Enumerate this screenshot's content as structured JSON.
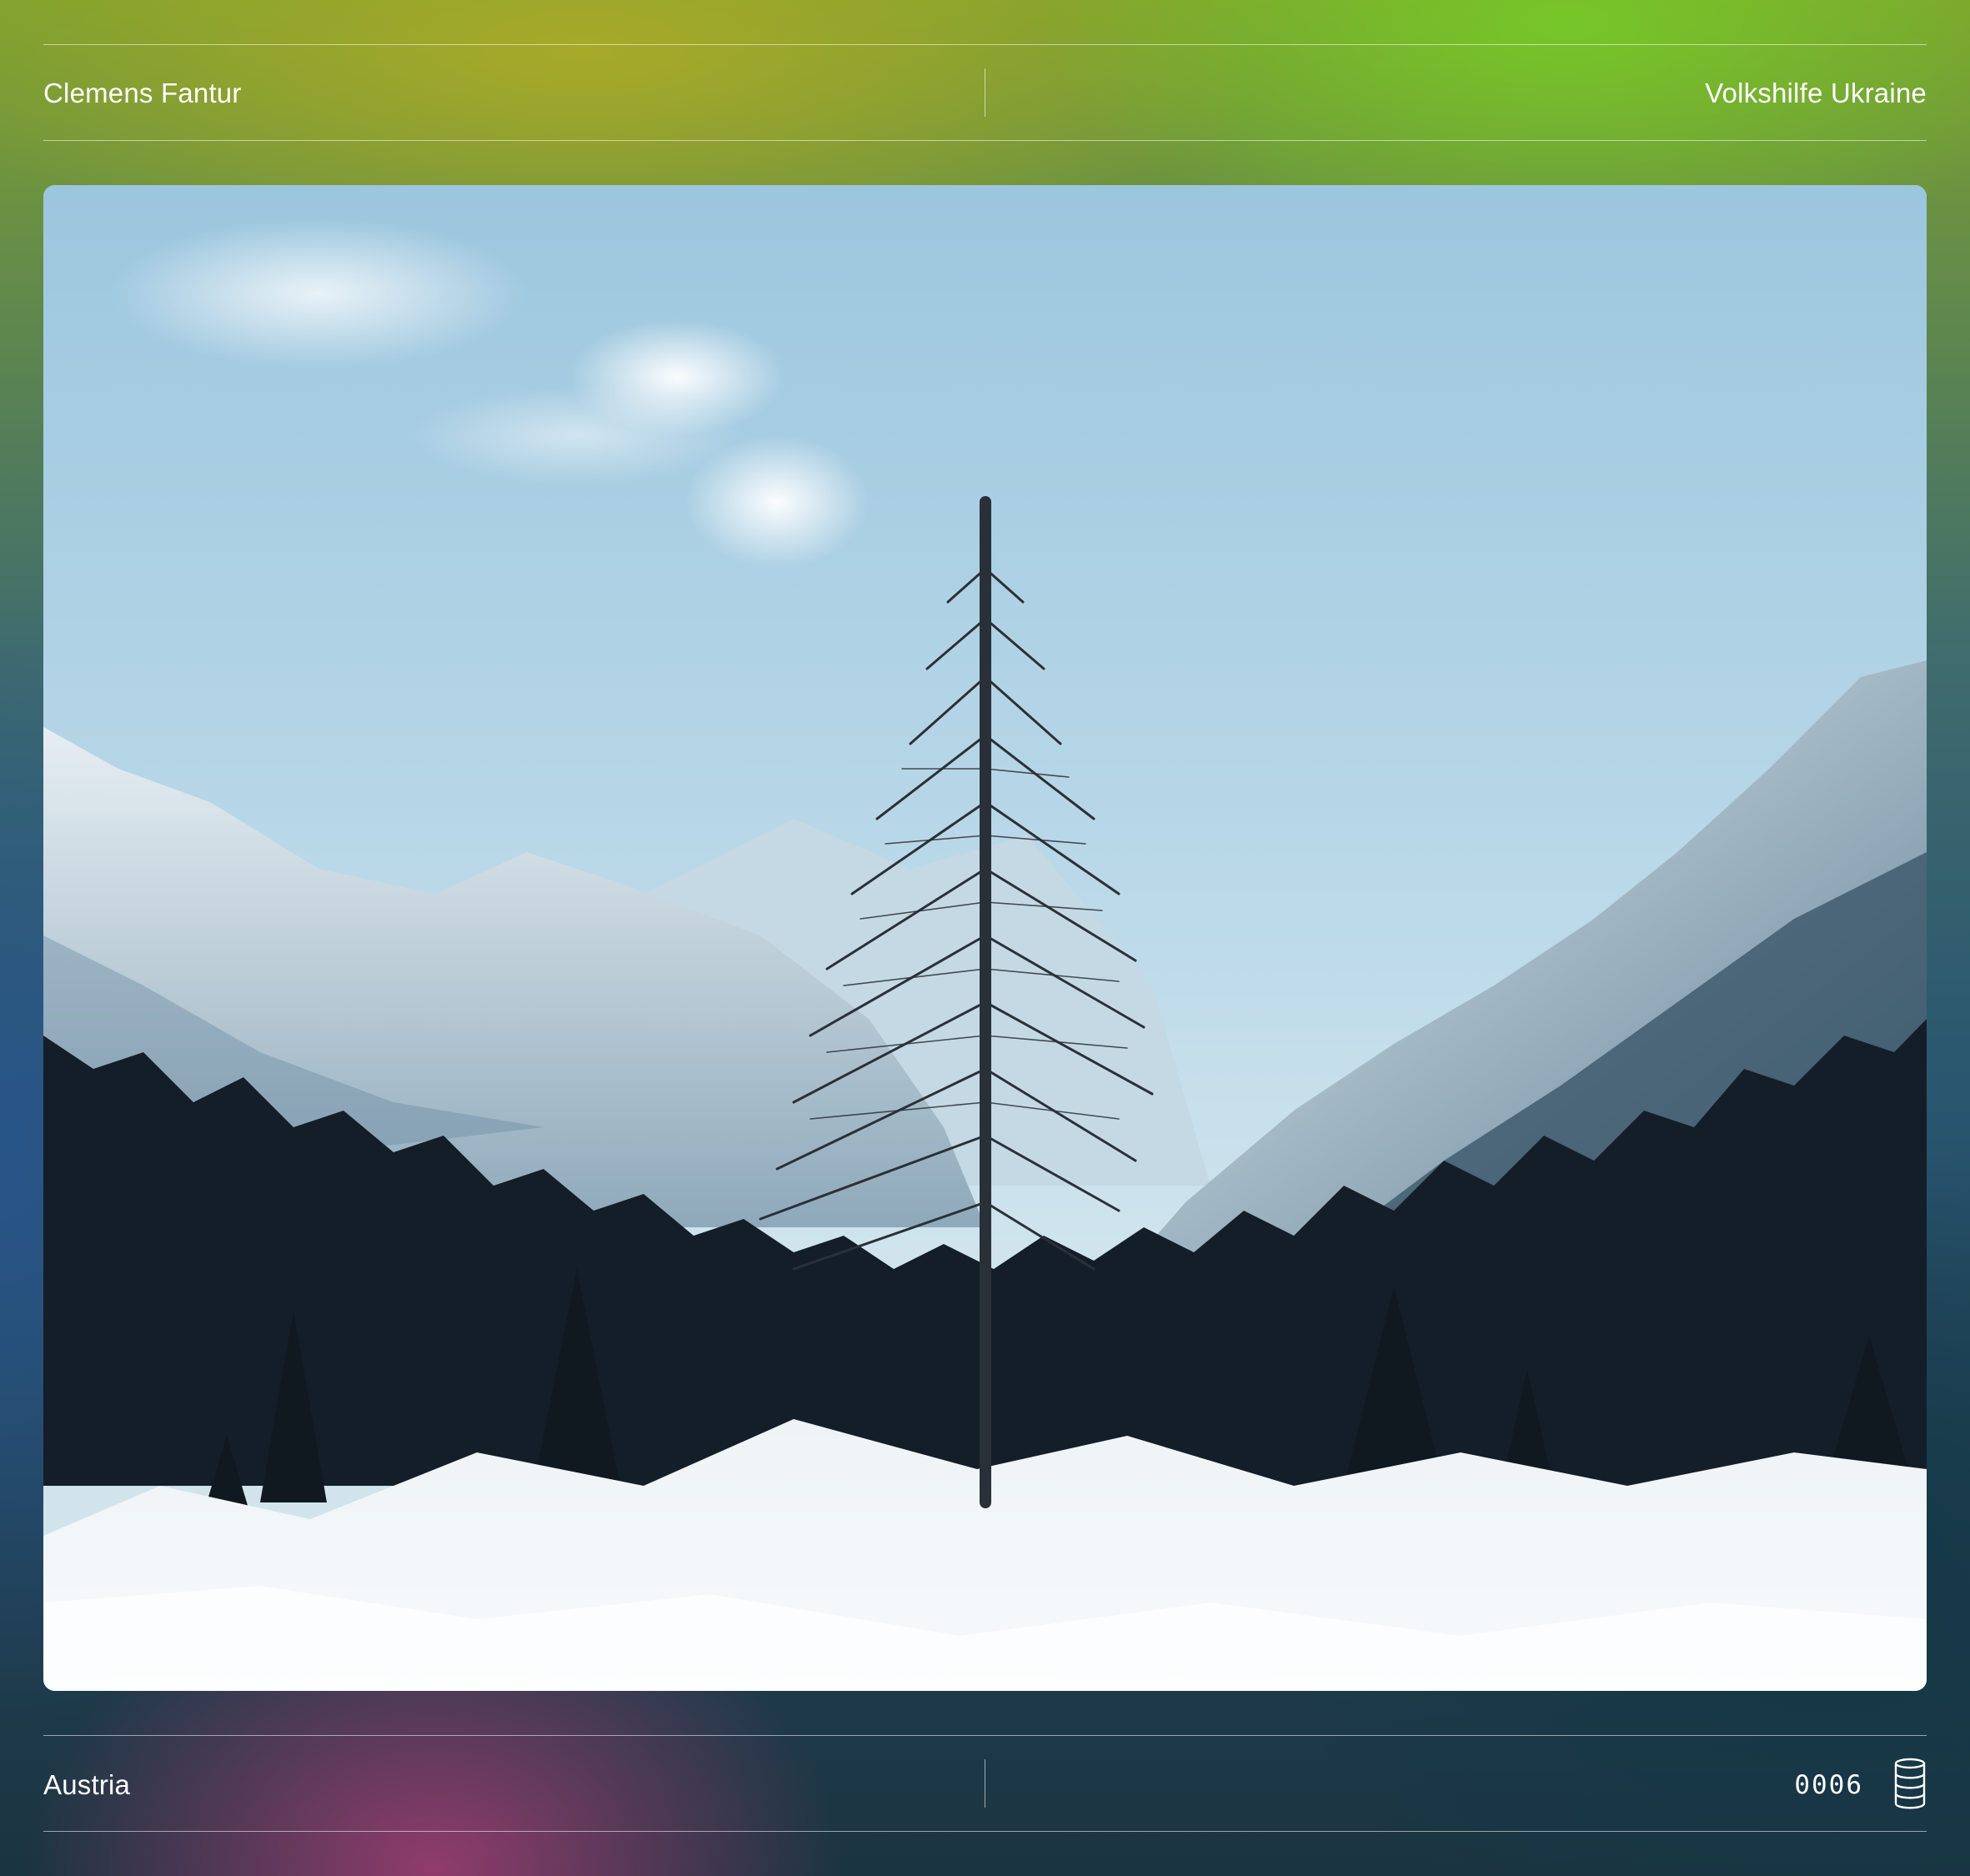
{
  "header": {
    "left_label": "Clemens Fantur",
    "right_label": "Volkshilfe Ukraine"
  },
  "footer": {
    "left_label": "Austria",
    "counter": "0006",
    "icon": "database-icon"
  },
  "photo": {
    "subject": "snowy-alpine-valley-with-bare-larch-tree"
  }
}
